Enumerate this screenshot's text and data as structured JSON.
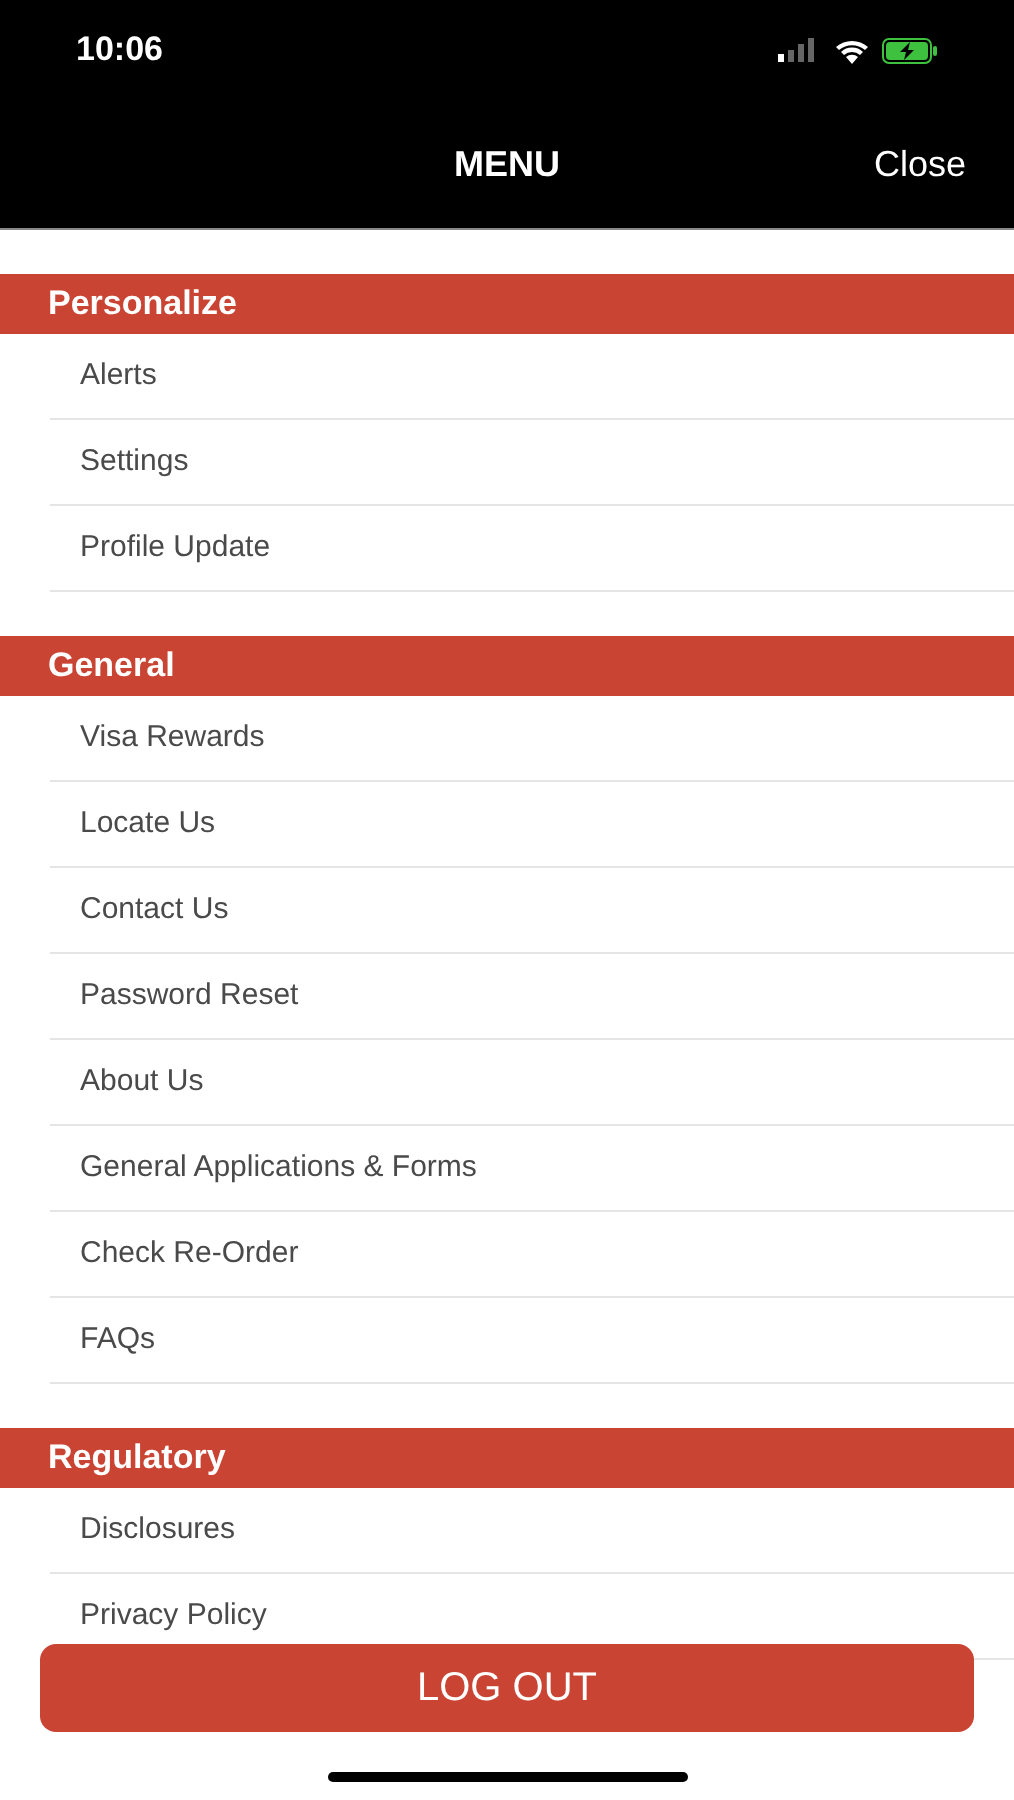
{
  "status_bar": {
    "time": "10:06"
  },
  "nav_bar": {
    "title": "MENU",
    "close": "Close"
  },
  "sections": [
    {
      "title": "Personalize",
      "items": [
        "Alerts",
        "Settings",
        "Profile Update"
      ]
    },
    {
      "title": "General",
      "items": [
        "Visa Rewards",
        "Locate Us",
        "Contact Us",
        "Password Reset",
        "About Us",
        "General Applications & Forms",
        "Check Re-Order",
        "FAQs"
      ]
    },
    {
      "title": "Regulatory",
      "items": [
        "Disclosures",
        "Privacy Policy"
      ]
    }
  ],
  "logout_button": "LOG OUT"
}
